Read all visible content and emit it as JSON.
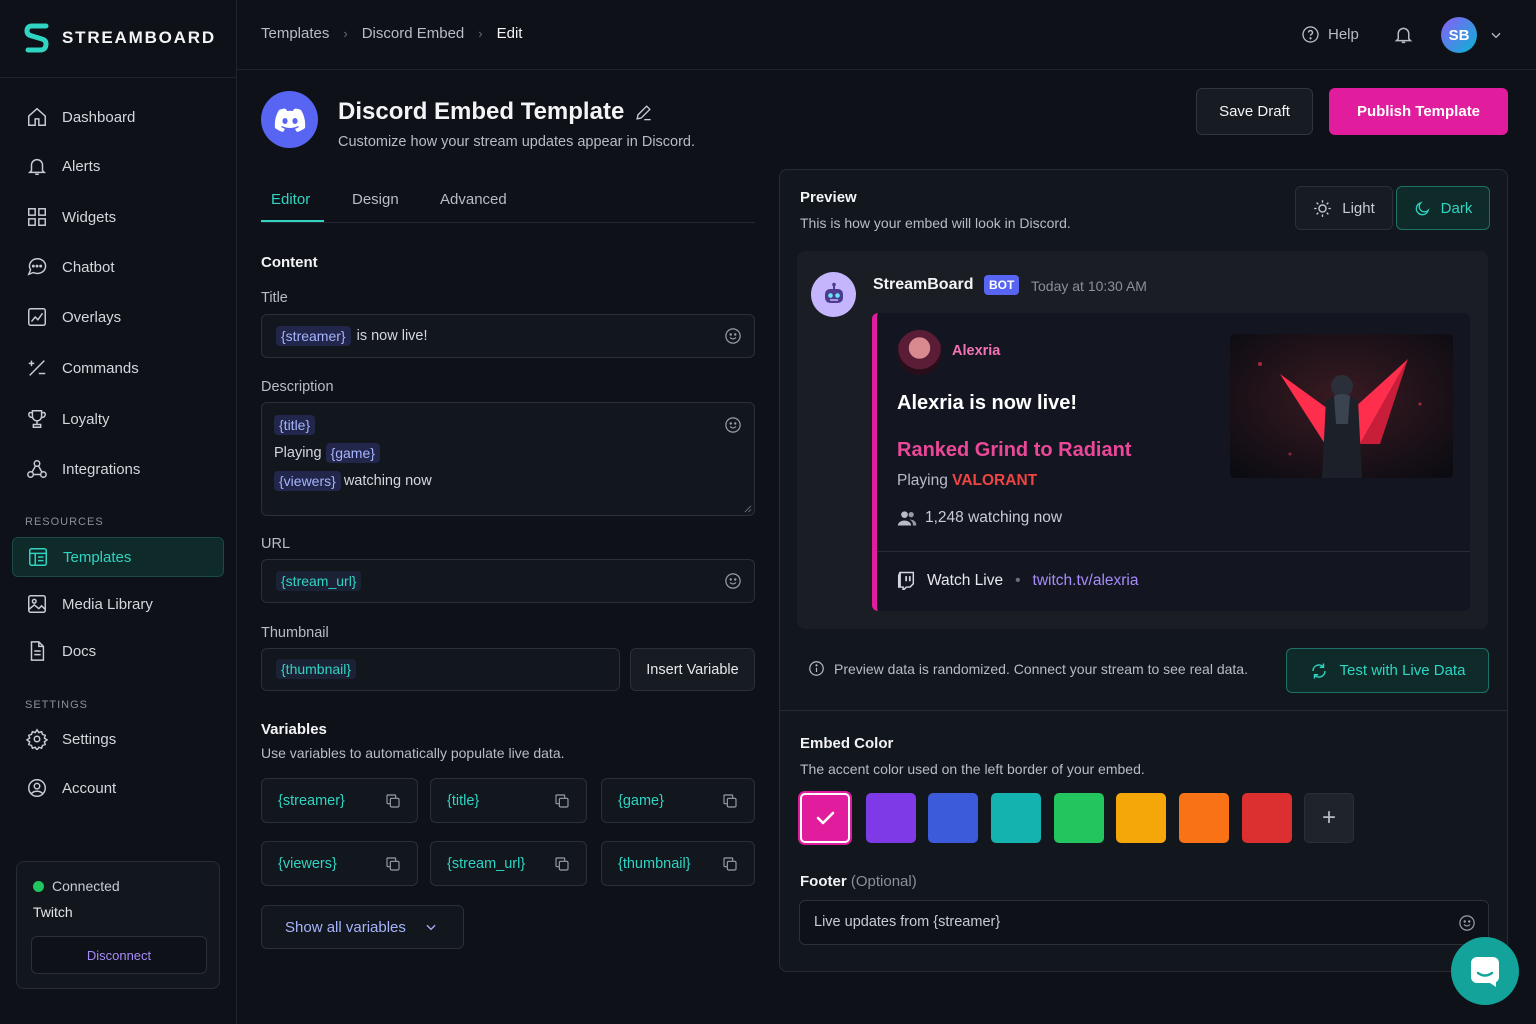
{
  "app": {
    "name": "STREAMBOARD"
  },
  "sidebar": {
    "items": [
      {
        "label": "Dashboard",
        "icon": "home-icon"
      },
      {
        "label": "Alerts",
        "icon": "bell-icon"
      },
      {
        "label": "Widgets",
        "icon": "grid-icon"
      },
      {
        "label": "Chatbot",
        "icon": "chat-icon"
      },
      {
        "label": "Overlays",
        "icon": "image-chart-icon"
      },
      {
        "label": "Commands",
        "icon": "plus-minus-icon"
      },
      {
        "label": "Loyalty",
        "icon": "trophy-icon"
      },
      {
        "label": "Integrations",
        "icon": "nodes-icon"
      }
    ],
    "resources_label": "RESOURCES",
    "resources": [
      {
        "label": "Templates",
        "icon": "template-icon",
        "active": true
      },
      {
        "label": "Media Library",
        "icon": "image-icon"
      },
      {
        "label": "Docs",
        "icon": "document-icon"
      }
    ],
    "settings_label": "SETTINGS",
    "settings": [
      {
        "label": "Settings",
        "icon": "gear-icon"
      },
      {
        "label": "Account",
        "icon": "user-circle-icon"
      }
    ],
    "connection": {
      "status": "Connected",
      "platform": "Twitch",
      "button": "Disconnect",
      "status_color": "#22c55e"
    }
  },
  "topbar": {
    "breadcrumbs": [
      "Templates",
      "Discord Embed",
      "Edit"
    ],
    "help": "Help",
    "avatar_initials": "SB"
  },
  "header": {
    "title": "Discord Embed Template",
    "subtitle": "Customize how your stream updates appear in Discord.",
    "save_draft": "Save Draft",
    "publish": "Publish Template"
  },
  "tabs": [
    "Editor",
    "Design",
    "Advanced"
  ],
  "editor": {
    "content_heading": "Content",
    "title_label": "Title",
    "title_var": "{streamer}",
    "title_text": "is now live!",
    "description_label": "Description",
    "desc_line1_var": "{title}",
    "desc_line2_text": "Playing",
    "desc_line2_var": "{game}",
    "desc_line3_var": "{viewers}",
    "desc_line3_text": "watching now",
    "url_label": "URL",
    "url_var": "{stream_url}",
    "thumbnail_label": "Thumbnail",
    "thumbnail_var": "{thumbnail}",
    "insert_variable": "Insert Variable",
    "variables_heading": "Variables",
    "variables_sub": "Use variables to automatically populate live data.",
    "variables": [
      "{streamer}",
      "{title}",
      "{game}",
      "{viewers}",
      "{stream_url}",
      "{thumbnail}"
    ],
    "show_all": "Show all variables"
  },
  "preview": {
    "title": "Preview",
    "subtitle": "This is how your embed will look in Discord.",
    "light": "Light",
    "dark": "Dark",
    "bot_name": "StreamBoard",
    "bot_badge": "BOT",
    "timestamp": "Today at 10:30 AM",
    "author": "Alexria",
    "embed_title": "Alexria is now live!",
    "embed_desc": "Ranked Grind to Radiant",
    "playing_prefix": "Playing",
    "game": "VALORANT",
    "watching": "1,248 watching now",
    "footer_action": "Watch Live",
    "footer_link": "twitch.tv/alexria",
    "info": "Preview data is randomized. Connect your stream to see real data.",
    "test_button": "Test with Live Data"
  },
  "embed_color": {
    "title": "Embed Color",
    "subtitle": "The accent color used on the left border of your embed.",
    "swatches": [
      "#e11d9e",
      "#7e3ae6",
      "#3b5bdb",
      "#14b3b0",
      "#22c55e",
      "#f5a70a",
      "#f97316",
      "#dc2f2f"
    ],
    "selected": "#e11d9e"
  },
  "footer": {
    "label": "Footer",
    "optional": "(Optional)",
    "value": "Live updates from {streamer}"
  }
}
